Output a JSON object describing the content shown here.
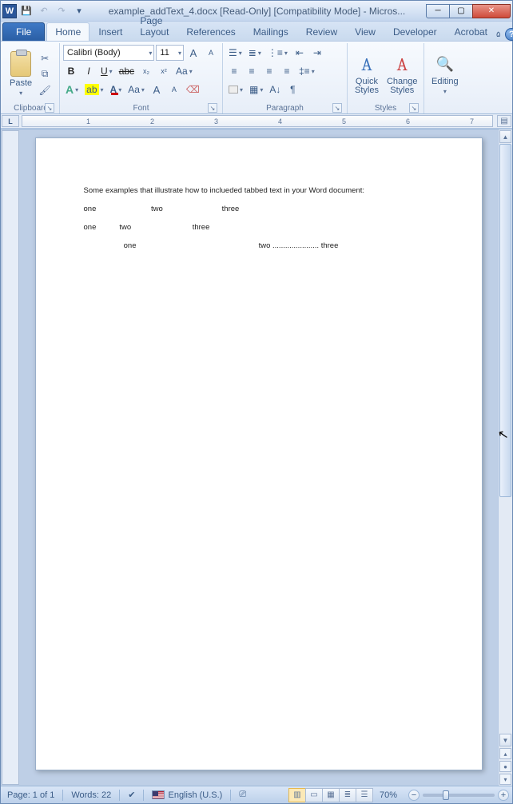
{
  "titlebar": {
    "app_icon_letter": "W",
    "title": "example_addText_4.docx [Read-Only] [Compatibility Mode] - Micros..."
  },
  "qat": {
    "save": "💾",
    "undo": "↶",
    "redo": "↷",
    "customize": "▾"
  },
  "tabs": {
    "file": "File",
    "items": [
      "Home",
      "Insert",
      "Page Layout",
      "References",
      "Mailings",
      "Review",
      "View",
      "Developer",
      "Acrobat"
    ],
    "active": "Home"
  },
  "ribbon": {
    "clipboard": {
      "label": "Clipboard",
      "paste": "Paste",
      "cut": "✂",
      "copy": "⧉",
      "format_painter": "🖌"
    },
    "font": {
      "label": "Font",
      "family": "Calibri (Body)",
      "size": "11",
      "grow": "A",
      "shrink": "A",
      "bold": "B",
      "italic": "I",
      "underline": "U",
      "strike": "abc",
      "subscript": "x₂",
      "superscript": "x²",
      "case": "Aa",
      "clear": "⌫",
      "highlight": "ab",
      "font_color": "A"
    },
    "paragraph": {
      "label": "Paragraph"
    },
    "styles": {
      "label": "Styles",
      "quick": "Quick\nStyles",
      "change": "Change\nStyles"
    },
    "editing": {
      "label": "Editing",
      "btn": "Editing"
    }
  },
  "document": {
    "lines": [
      "Some examples that illustrate how to inclueded tabbed text in your Word document:",
      "one                          two                            three",
      "one           two                             three",
      "                   one                                                          two ...................... three"
    ]
  },
  "statusbar": {
    "page": "Page: 1 of 1",
    "words": "Words: 22",
    "language": "English (U.S.)",
    "zoom": "70%"
  }
}
